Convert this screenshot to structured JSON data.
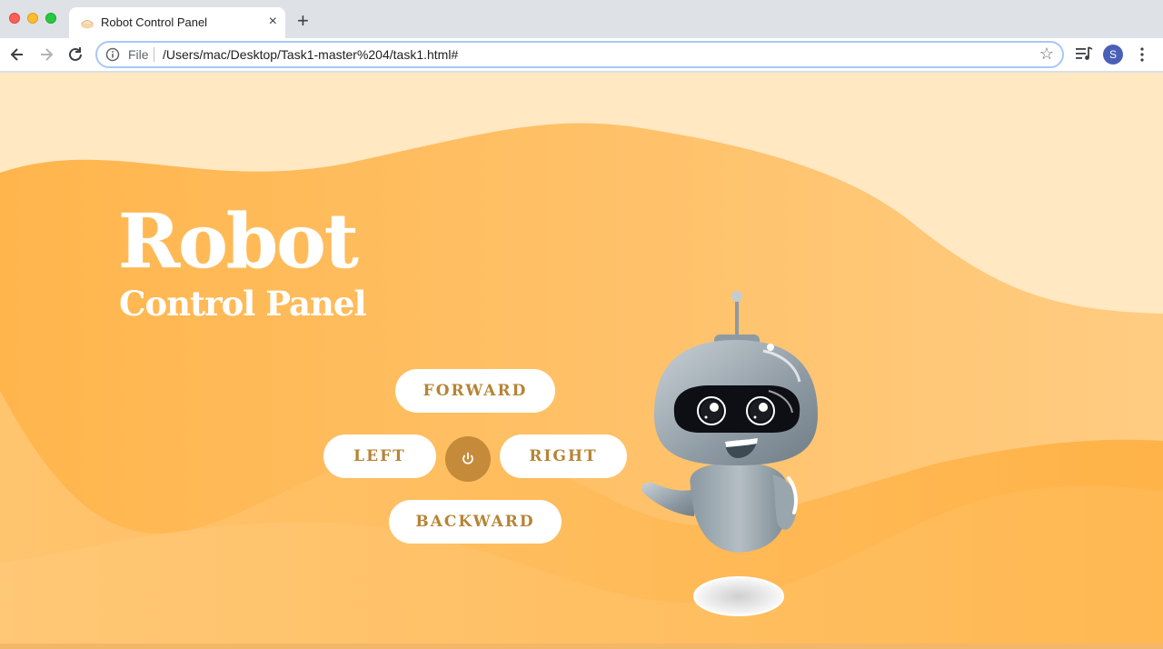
{
  "browser": {
    "tab_title": "Robot Control Panel",
    "tab_close": "×",
    "new_tab": "+",
    "scheme_label": "File",
    "url": "/Users/mac/Desktop/Task1-master%204/task1.html#",
    "profile_initial": "S"
  },
  "hero": {
    "title": "Robot",
    "subtitle": "Control Panel"
  },
  "controls": {
    "forward": "FORWARD",
    "left": "LEFT",
    "right": "RIGHT",
    "backward": "BACKWARD",
    "power_icon": "power-icon"
  },
  "colors": {
    "accent": "#b58434",
    "power_button": "#c58a3a",
    "background_light": "#ffe8c2",
    "background_orange": "#ffb95a"
  }
}
